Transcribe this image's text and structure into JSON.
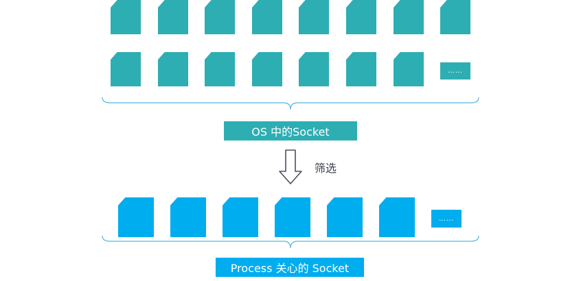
{
  "os_group": {
    "label": "OS 中的Socket",
    "ellipsis": "……",
    "color": "#2daeb3"
  },
  "arrow": {
    "label": "筛选",
    "color": "#4a5060"
  },
  "process_group": {
    "label": "Process 关心的 Socket",
    "ellipsis": "……",
    "color": "#00adef"
  },
  "brace_color": "#4fb8e0"
}
